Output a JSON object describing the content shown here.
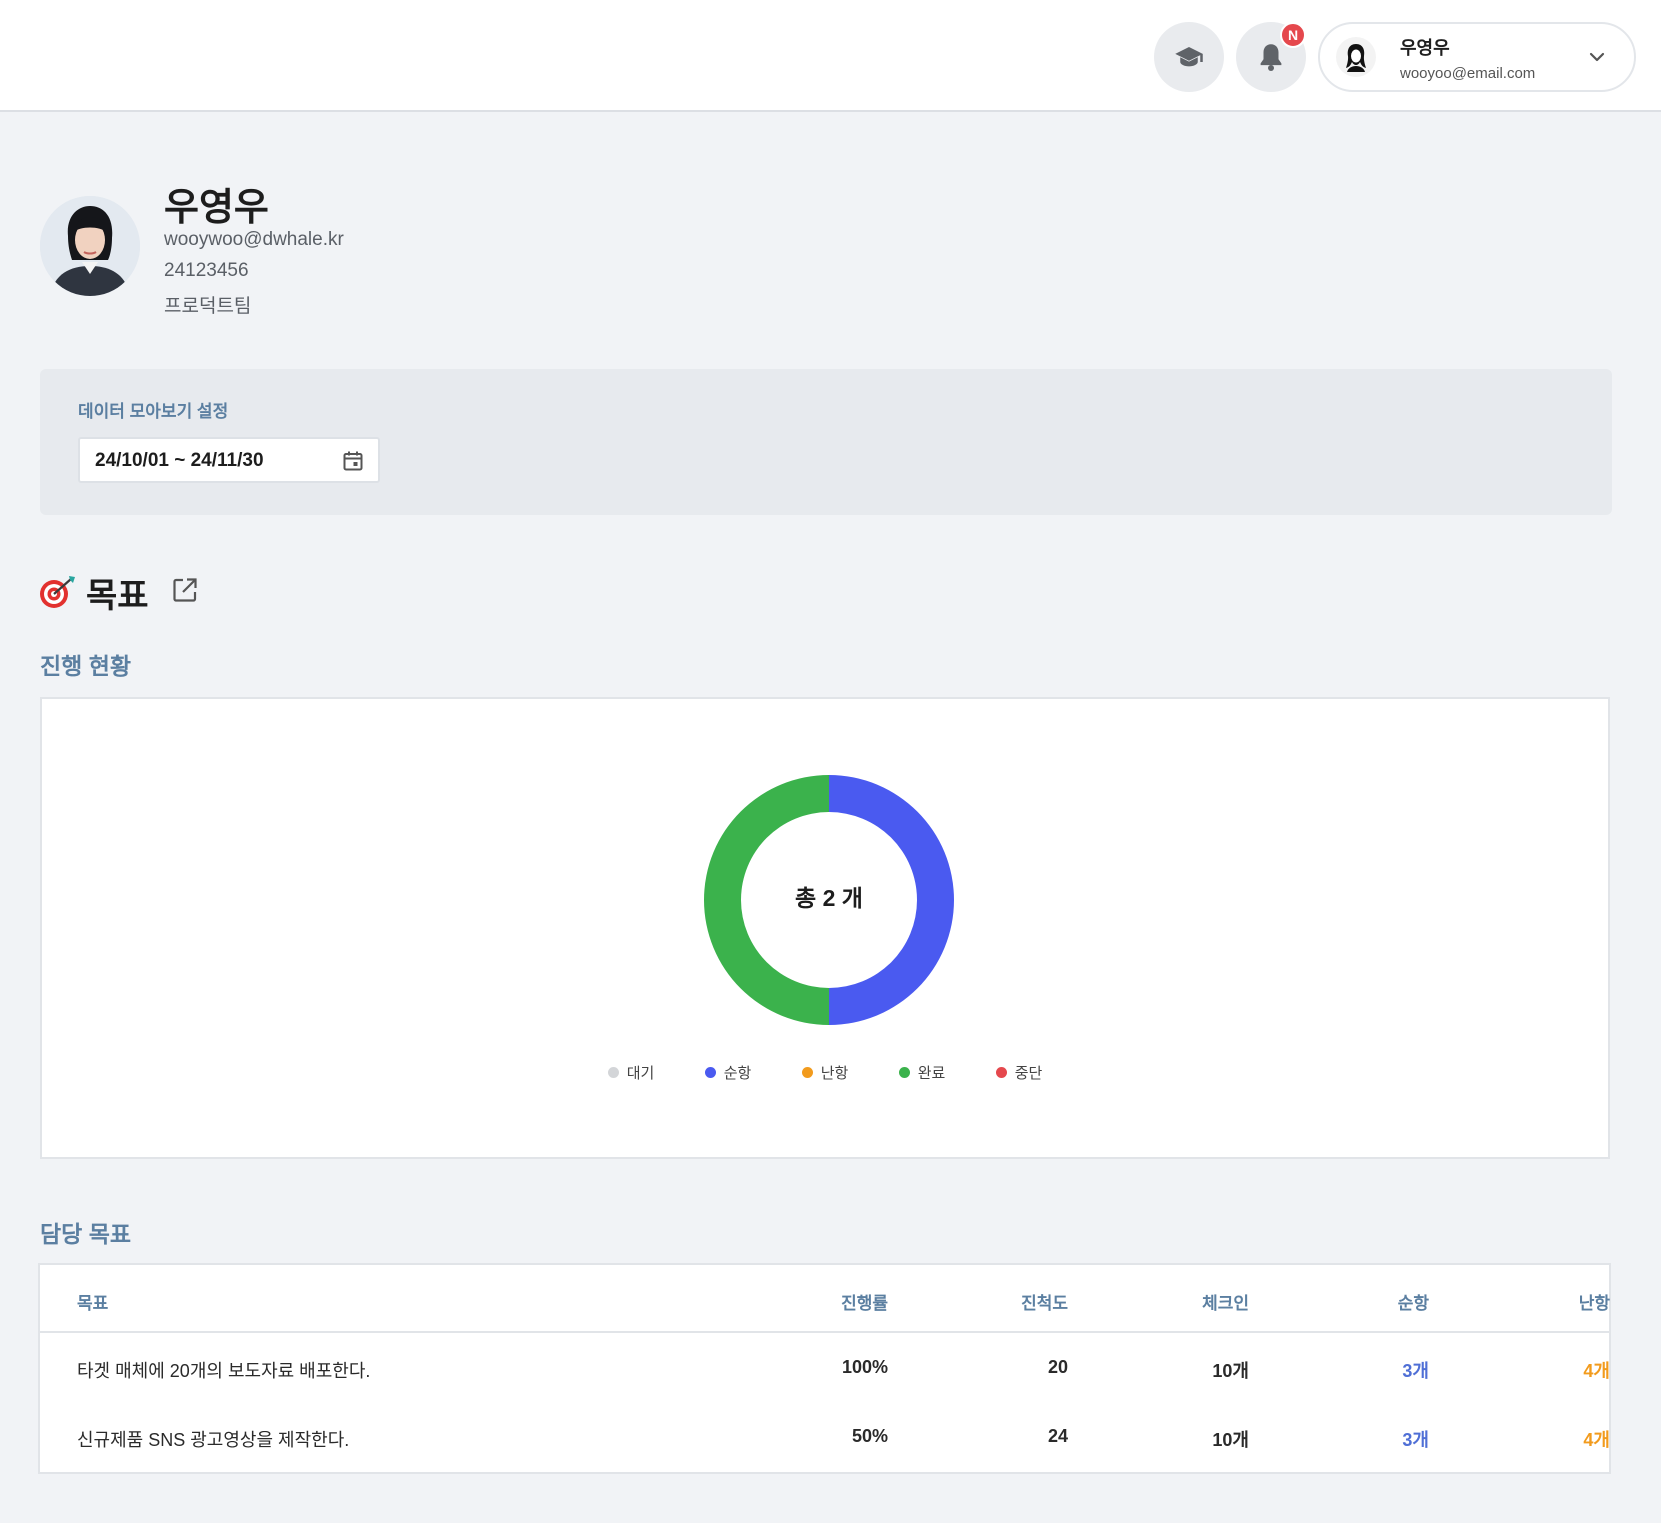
{
  "header": {
    "user_name": "우영우",
    "user_email": "wooyoo@email.com",
    "notification_badge": "N",
    "icons": [
      "graduation-cap-icon",
      "bell-icon",
      "chevron-down-icon"
    ]
  },
  "profile": {
    "name": "우영우",
    "email": "wooywoo@dwhale.kr",
    "employee_id": "24123456",
    "team": "프로덕트팀"
  },
  "settings": {
    "label": "데이터 모아보기 설정",
    "date_range": "24/10/01 ~ 24/11/30"
  },
  "goal": {
    "title": "목표",
    "progress_title": "진행 현황",
    "assigned_title": "담당 목표"
  },
  "chart_data": {
    "type": "pie",
    "center_label": "총 2 개",
    "categories": [
      "대기",
      "순항",
      "난항",
      "완료",
      "중단"
    ],
    "values": [
      0,
      1,
      0,
      1,
      0
    ],
    "colors": [
      "#d3d5d8",
      "#4a5af0",
      "#f29b1d",
      "#3bb24c",
      "#e5484d"
    ]
  },
  "table": {
    "columns": [
      "목표",
      "진행률",
      "진척도",
      "체크인",
      "순항",
      "난항"
    ],
    "rows": [
      [
        "타겟 매체에 20개의 보도자료 배포한다.",
        "100%",
        "20",
        "10개",
        "3개",
        "4개"
      ],
      [
        "신규제품 SNS 광고영상을 제작한다.",
        "50%",
        "24",
        "10개",
        "3개",
        "4개"
      ]
    ]
  }
}
